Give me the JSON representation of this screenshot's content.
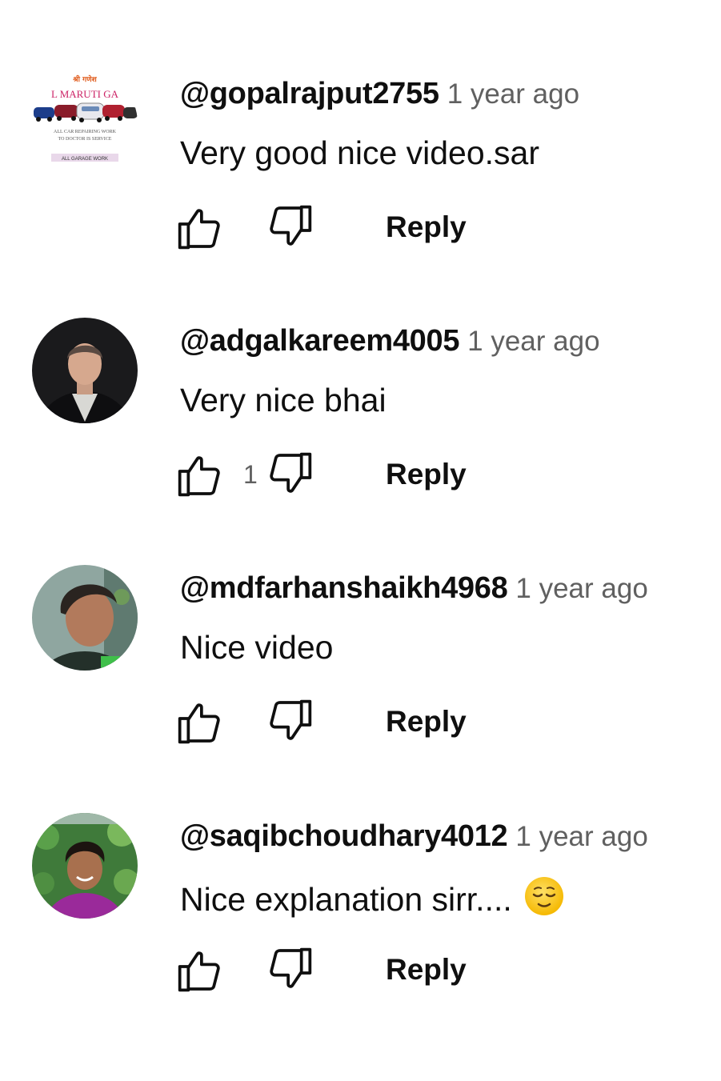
{
  "comments": [
    {
      "author": "@gopalrajput2755",
      "time": "1 year ago",
      "text": "Very good nice video.sar",
      "likes": "",
      "reply_label": "Reply",
      "avatar": {
        "type": "logo",
        "top_text": "श्री गणेश",
        "name_text": "L MARUTI GA",
        "line1": "ALL CAR REPAIRING WORK",
        "line2": "TO DOCTOR IS SERVICE",
        "line3": "ALL GARAGE WORK"
      }
    },
    {
      "author": "@adgalkareem4005",
      "time": "1 year ago",
      "text": "Very nice bhai",
      "likes": "1",
      "reply_label": "Reply",
      "avatar": {
        "type": "photo"
      }
    },
    {
      "author": "@mdfarhanshaikh4968",
      "time": "1 year ago",
      "text": "Nice video",
      "likes": "",
      "reply_label": "Reply",
      "avatar": {
        "type": "photo"
      }
    },
    {
      "author": "@saqibchoudhary4012",
      "time": "1 year ago",
      "text": "Nice explanation sirr....",
      "emoji": "relieved-face",
      "likes": "",
      "reply_label": "Reply",
      "avatar": {
        "type": "photo"
      }
    }
  ],
  "icons": {
    "like": "thumbs-up-outline-icon",
    "dislike": "thumbs-down-outline-icon"
  },
  "colors": {
    "text": "#0f0f0f",
    "secondary": "#606060",
    "background": "#ffffff"
  }
}
